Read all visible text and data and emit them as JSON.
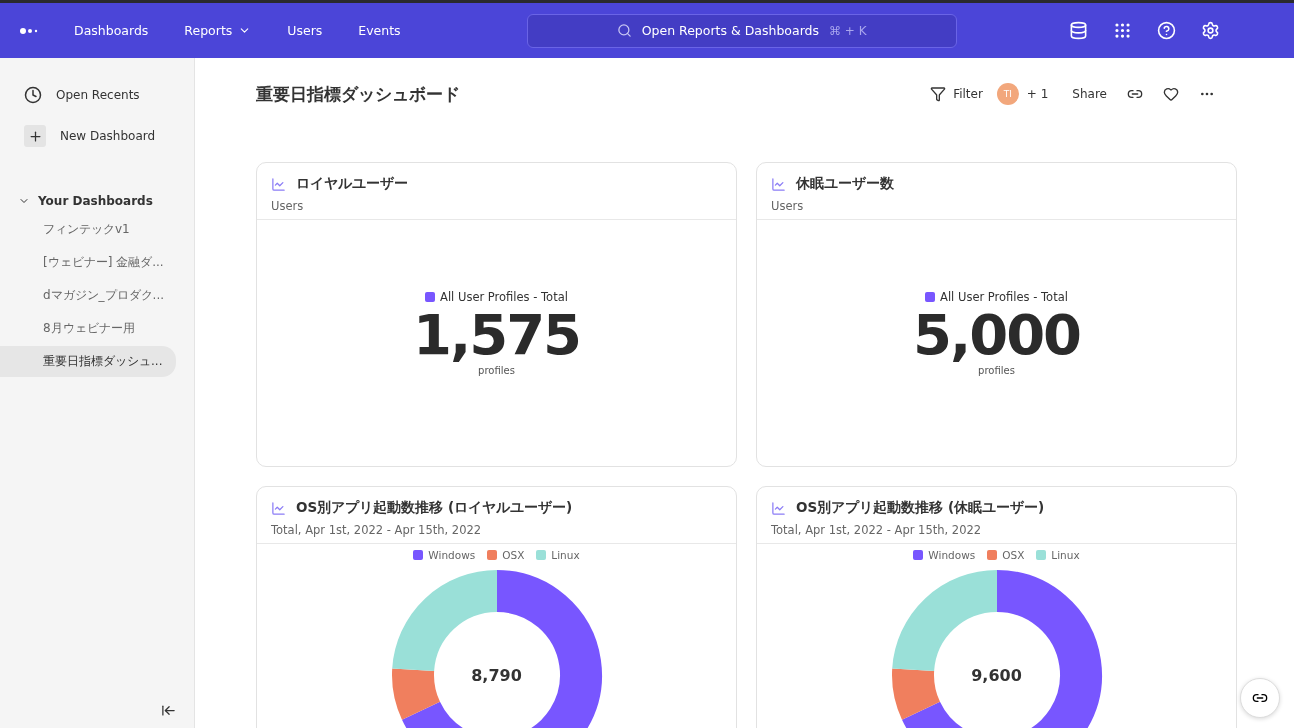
{
  "topbar": {
    "nav": [
      {
        "label": "Dashboards",
        "has_menu": false
      },
      {
        "label": "Reports",
        "has_menu": true
      },
      {
        "label": "Users",
        "has_menu": false
      },
      {
        "label": "Events",
        "has_menu": false
      }
    ],
    "search": {
      "placeholder": "Open Reports & Dashboards",
      "shortcut": "⌘ + K"
    }
  },
  "sidebar": {
    "actions": [
      {
        "kind": "recents",
        "label": "Open Recents"
      },
      {
        "kind": "new",
        "label": "New Dashboard"
      }
    ],
    "section": {
      "label": "Your Dashboards",
      "expanded": true,
      "items": [
        {
          "label": "フィンテックv1",
          "selected": false
        },
        {
          "label": "[ウェビナー] 金融ダ...",
          "selected": false
        },
        {
          "label": "dマガジン_プロダク...",
          "selected": false
        },
        {
          "label": "8月ウェビナー用",
          "selected": false
        },
        {
          "label": "重要日指標ダッシュ...",
          "selected": true
        }
      ]
    }
  },
  "header": {
    "title": "重要日指標ダッシュボード",
    "filter": "Filter",
    "avatar": "TI",
    "extra_users": "+ 1",
    "share": "Share"
  },
  "cards": [
    {
      "kind": "metric",
      "title": "ロイヤルユーザー",
      "subtitle": "Users",
      "legend": {
        "label": "All User Profiles - Total",
        "color": "#7856ff"
      },
      "value": "1,575",
      "unit": "profiles"
    },
    {
      "kind": "metric",
      "title": "休眠ユーザー数",
      "subtitle": "Users",
      "legend": {
        "label": "All User Profiles - Total",
        "color": "#7856ff"
      },
      "value": "5,000",
      "unit": "profiles"
    },
    {
      "kind": "donut",
      "title": "OS別アプリ起動数推移 (ロイヤルユーザー)",
      "subtitle": "Total, Apr 1st, 2022 - Apr 15th, 2022",
      "legend": [
        {
          "label": "Windows",
          "color": "#7856ff"
        },
        {
          "label": "OSX",
          "color": "#f07f5e"
        },
        {
          "label": "Linux",
          "color": "#9ae0d8"
        }
      ],
      "total": "8,790"
    },
    {
      "kind": "donut",
      "title": "OS別アプリ起動数推移 (休眠ユーザー)",
      "subtitle": "Total, Apr 1st, 2022 - Apr 15th, 2022",
      "legend": [
        {
          "label": "Windows",
          "color": "#7856ff"
        },
        {
          "label": "OSX",
          "color": "#f07f5e"
        },
        {
          "label": "Linux",
          "color": "#9ae0d8"
        }
      ],
      "total": "9,600"
    }
  ]
}
